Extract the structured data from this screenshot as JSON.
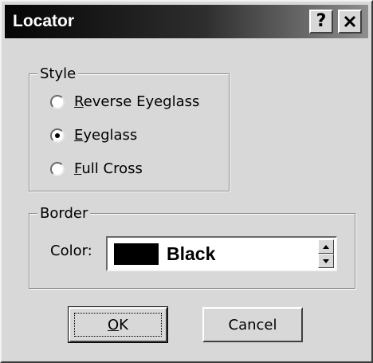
{
  "window": {
    "title": "Locator",
    "help_glyph": "?"
  },
  "style_group": {
    "legend": "Style",
    "options": [
      {
        "label": "Reverse Eyeglass",
        "selected": false
      },
      {
        "label": "Eyeglass",
        "selected": true
      },
      {
        "label": "Full Cross",
        "selected": false
      }
    ]
  },
  "border_group": {
    "legend": "Border",
    "color_label": "Color:",
    "color_value": "Black",
    "swatch_color": "#000000"
  },
  "buttons": {
    "ok": "OK",
    "cancel": "Cancel"
  },
  "icons": {
    "help": "help-icon",
    "close": "close-icon",
    "spin_up": "arrow-up-icon",
    "spin_down": "arrow-down-icon"
  }
}
